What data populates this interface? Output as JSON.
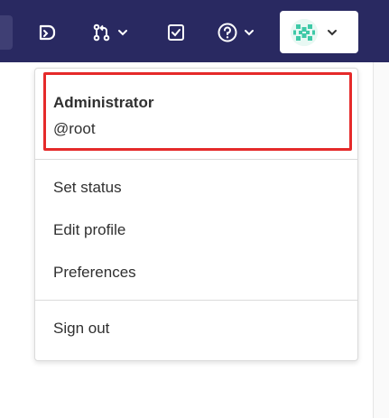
{
  "topbar": {
    "icons": [
      {
        "name": "issues-icon"
      },
      {
        "name": "merge-requests-icon"
      },
      {
        "name": "todos-icon"
      },
      {
        "name": "help-icon"
      }
    ],
    "avatar_icon": "identicon-avatar",
    "colors": {
      "background": "#292961",
      "avatar_accent": "#3ec9a7"
    }
  },
  "dropdown": {
    "user": {
      "name": "Administrator",
      "handle": "@root"
    },
    "highlight_color": "#e52a2a",
    "items": [
      {
        "label": "Set status"
      },
      {
        "label": "Edit profile"
      },
      {
        "label": "Preferences"
      }
    ],
    "sign_out_label": "Sign out"
  }
}
